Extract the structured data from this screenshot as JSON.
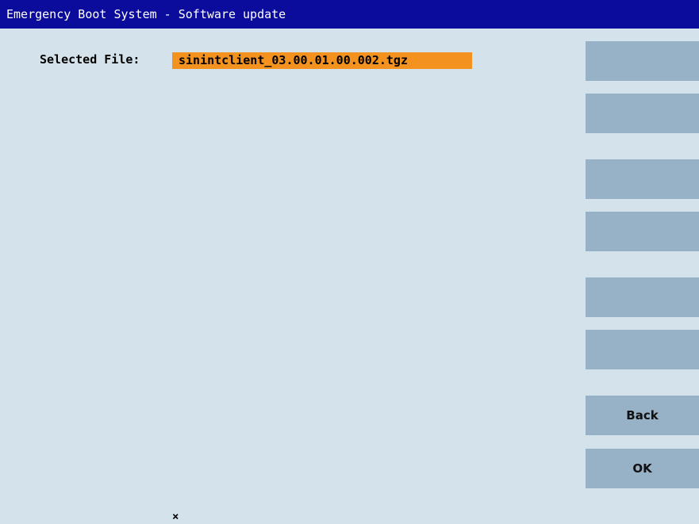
{
  "window": {
    "title": "Emergency Boot System - Software update"
  },
  "selection": {
    "label": "Selected File:",
    "file": "sinintclient_03.00.01.00.002.tgz"
  },
  "softkeys": [
    {
      "label": ""
    },
    {
      "label": ""
    },
    {
      "label": ""
    },
    {
      "label": ""
    },
    {
      "label": ""
    },
    {
      "label": ""
    },
    {
      "label": "Back"
    },
    {
      "label": "OK"
    }
  ],
  "status": {
    "cursor_glyph": "×"
  },
  "colors": {
    "titlebar": "#0b0b9c",
    "background": "#d4e3eb",
    "highlight": "#f4921f",
    "softkey": "#97b1c6"
  }
}
